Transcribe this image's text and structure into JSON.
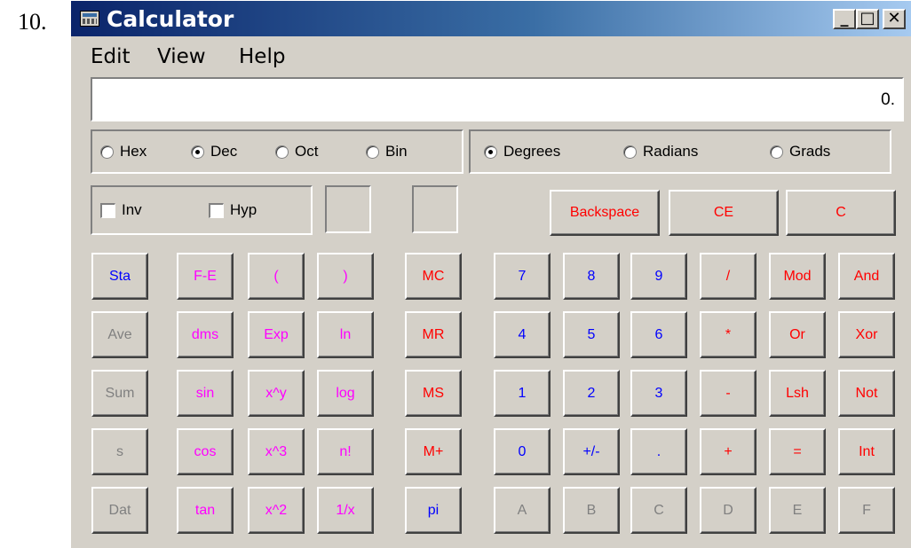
{
  "item_number": "10.",
  "window": {
    "title": "Calculator",
    "controls": [
      "_",
      "□",
      "✕"
    ]
  },
  "menu": [
    "Edit",
    "View",
    "Help"
  ],
  "display": "0.",
  "base_options": [
    {
      "label": "Hex",
      "selected": false
    },
    {
      "label": "Dec",
      "selected": true
    },
    {
      "label": "Oct",
      "selected": false
    },
    {
      "label": "Bin",
      "selected": false
    }
  ],
  "angle_options": [
    {
      "label": "Degrees",
      "selected": true
    },
    {
      "label": "Radians",
      "selected": false
    },
    {
      "label": "Grads",
      "selected": false
    }
  ],
  "checkboxes": [
    {
      "label": "Inv",
      "checked": false
    },
    {
      "label": "Hyp",
      "checked": false
    }
  ],
  "clear_buttons": [
    "Backspace",
    "CE",
    "C"
  ],
  "buttons": [
    [
      [
        "Sta",
        "blue"
      ],
      [
        "F-E",
        "mag"
      ],
      [
        "(",
        "mag"
      ],
      [
        ")",
        "mag"
      ],
      [
        "MC",
        "red"
      ],
      [
        "7",
        "blue"
      ],
      [
        "8",
        "blue"
      ],
      [
        "9",
        "blue"
      ],
      [
        "/",
        "red"
      ],
      [
        "Mod",
        "red"
      ],
      [
        "And",
        "red"
      ]
    ],
    [
      [
        "Ave",
        "gray"
      ],
      [
        "dms",
        "mag"
      ],
      [
        "Exp",
        "mag"
      ],
      [
        "ln",
        "mag"
      ],
      [
        "MR",
        "red"
      ],
      [
        "4",
        "blue"
      ],
      [
        "5",
        "blue"
      ],
      [
        "6",
        "blue"
      ],
      [
        "*",
        "red"
      ],
      [
        "Or",
        "red"
      ],
      [
        "Xor",
        "red"
      ]
    ],
    [
      [
        "Sum",
        "gray"
      ],
      [
        "sin",
        "mag"
      ],
      [
        "x^y",
        "mag"
      ],
      [
        "log",
        "mag"
      ],
      [
        "MS",
        "red"
      ],
      [
        "1",
        "blue"
      ],
      [
        "2",
        "blue"
      ],
      [
        "3",
        "blue"
      ],
      [
        "-",
        "red"
      ],
      [
        "Lsh",
        "red"
      ],
      [
        "Not",
        "red"
      ]
    ],
    [
      [
        "s",
        "gray"
      ],
      [
        "cos",
        "mag"
      ],
      [
        "x^3",
        "mag"
      ],
      [
        "n!",
        "mag"
      ],
      [
        "M+",
        "red"
      ],
      [
        "0",
        "blue"
      ],
      [
        "+/-",
        "blue"
      ],
      [
        ".",
        "blue"
      ],
      [
        "+",
        "red"
      ],
      [
        "=",
        "red"
      ],
      [
        "Int",
        "red"
      ]
    ],
    [
      [
        "Dat",
        "gray"
      ],
      [
        "tan",
        "mag"
      ],
      [
        "x^2",
        "mag"
      ],
      [
        "1/x",
        "mag"
      ],
      [
        "pi",
        "blue"
      ],
      [
        "A",
        "gray"
      ],
      [
        "B",
        "gray"
      ],
      [
        "C",
        "gray"
      ],
      [
        "D",
        "gray"
      ],
      [
        "E",
        "gray"
      ],
      [
        "F",
        "gray"
      ]
    ]
  ],
  "colors": {
    "blue": "#0000ff",
    "red": "#ff0000",
    "magenta": "#ff00ff",
    "gray": "#808080",
    "face": "#d4d0c8"
  }
}
